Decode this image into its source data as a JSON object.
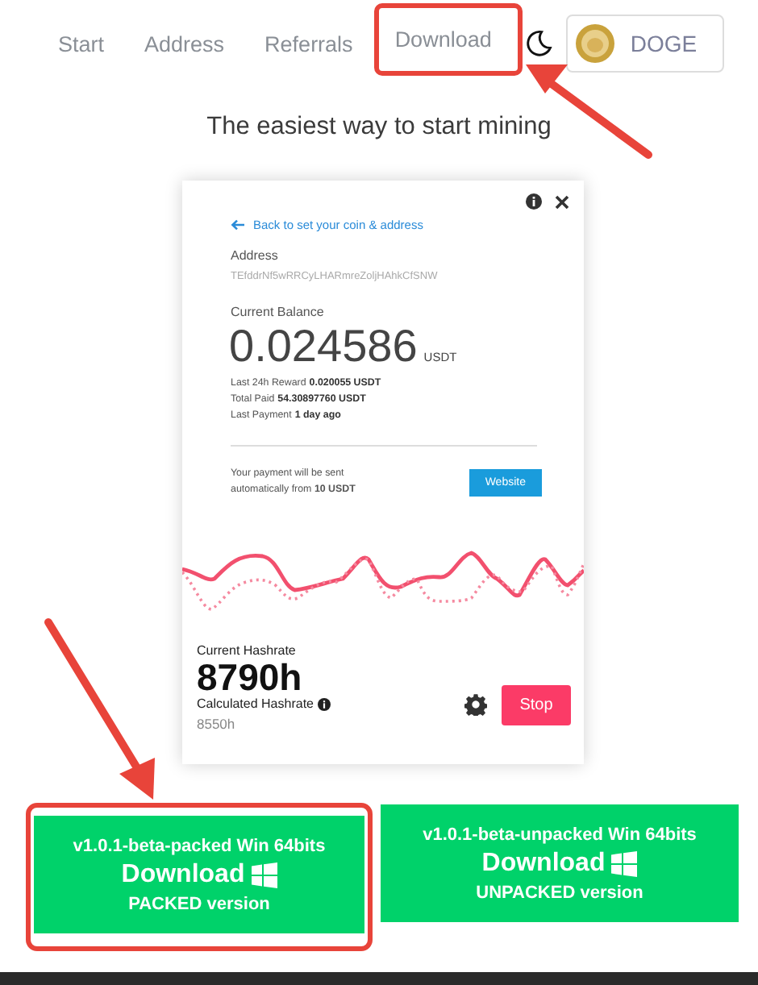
{
  "nav": {
    "items": [
      {
        "label": "Start",
        "highlighted": false
      },
      {
        "label": "Address",
        "highlighted": false
      },
      {
        "label": "Referrals",
        "highlighted": false
      },
      {
        "label": "Download",
        "highlighted": true
      }
    ],
    "coin": {
      "label": "DOGE"
    }
  },
  "heading": "The easiest way to start mining",
  "miner": {
    "back_link": "Back to set your coin & address",
    "address_label": "Address",
    "address": "TEfddrNf5wRRCyLHARmreZoljHAhkCfSNW",
    "balance_label": "Current Balance",
    "balance": "0.024586",
    "balance_unit": "USDT",
    "stats": [
      {
        "label": "Last 24h Reward",
        "value": "0.020055 USDT"
      },
      {
        "label": "Total Paid",
        "value": "54.30897760 USDT"
      },
      {
        "label": "Last Payment",
        "value": "1 day ago"
      }
    ],
    "payment_note": "Your payment will be sent automatically from **10 USDT**",
    "website_button": "Website",
    "hashrate_label": "Current Hashrate",
    "hashrate": "8790h",
    "calculated_label": "Calculated Hashrate",
    "calculated": "8550h",
    "stop_button": "Stop"
  },
  "downloads": [
    {
      "version": "v1.0.1-beta-packed Win 64bits",
      "action": "Download",
      "variant": "PACKED version",
      "highlighted": true
    },
    {
      "version": "v1.0.1-beta-unpacked Win 64bits",
      "action": "Download",
      "variant": "UNPACKED version",
      "highlighted": false
    }
  ]
}
